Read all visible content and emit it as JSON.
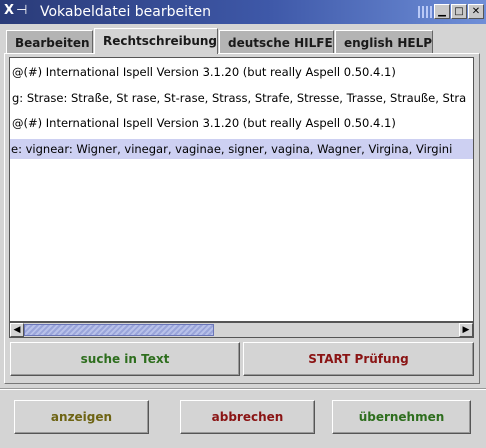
{
  "window": {
    "title": "Vokabeldatei bearbeiten",
    "menu_glyph": "X",
    "pin_glyph": "⊣",
    "minimize_glyph": "▁",
    "maximize_glyph": "□",
    "close_glyph": "✕"
  },
  "tabs": [
    {
      "label": "Bearbeiten"
    },
    {
      "label": "Rechtschreibung"
    },
    {
      "label": "deutsche HILFE"
    },
    {
      "label": "english HELP"
    }
  ],
  "active_tab": "Rechtschreibung",
  "output": {
    "lines": [
      "@(#) International Ispell Version 3.1.20 (but really Aspell 0.50.4.1)",
      "g: Strase: Straße, St rase, St-rase, Strass, Strafe, Stresse, Trasse, Strauße, Stra",
      "@(#) International Ispell Version 3.1.20 (but really Aspell 0.50.4.1)",
      "e: vignear: Wigner, vinegar, vaginae, signer, vagina, Wagner, Virgina, Virgini"
    ],
    "highlighted_line": 3
  },
  "scroll": {
    "left_arrow": "◀",
    "right_arrow": "▶"
  },
  "actions": {
    "search": {
      "label": "suche in Text",
      "color": "#2e6e1e"
    },
    "start": {
      "label": "START Prüfung",
      "color": "#8a1414"
    }
  },
  "footer": {
    "show": {
      "label": "anzeigen",
      "color": "#6e6414"
    },
    "cancel": {
      "label": "abbrechen",
      "color": "#8a1414"
    },
    "apply": {
      "label": "übernehmen",
      "color": "#2e6e1e"
    }
  }
}
